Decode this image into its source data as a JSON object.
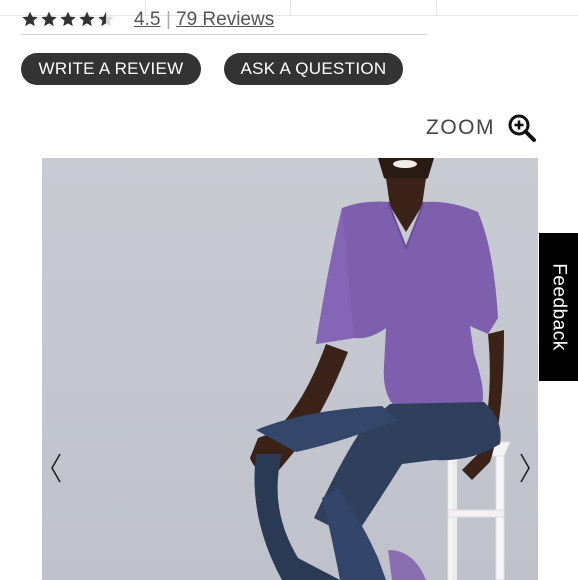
{
  "rating": {
    "value": "4.5",
    "separator": "|",
    "reviews_text": "79 Reviews",
    "stars_filled": 4.5,
    "stars_total": 5
  },
  "actions": {
    "write_review": "WRITE A REVIEW",
    "ask_question": "ASK A QUESTION"
  },
  "zoom": {
    "label": "ZOOM",
    "icon": "zoom-in-icon"
  },
  "gallery": {
    "prev_icon": "chevron-left-icon",
    "next_icon": "chevron-right-icon"
  },
  "feedback_tab": {
    "label": "Feedback"
  },
  "colors": {
    "button_bg": "#333333",
    "button_text": "#ffffff",
    "photo_bg": "#c6c9d1",
    "top_color": "#7d5fae",
    "jeans_color": "#2f3f5c",
    "feedback_bg": "#000000"
  }
}
